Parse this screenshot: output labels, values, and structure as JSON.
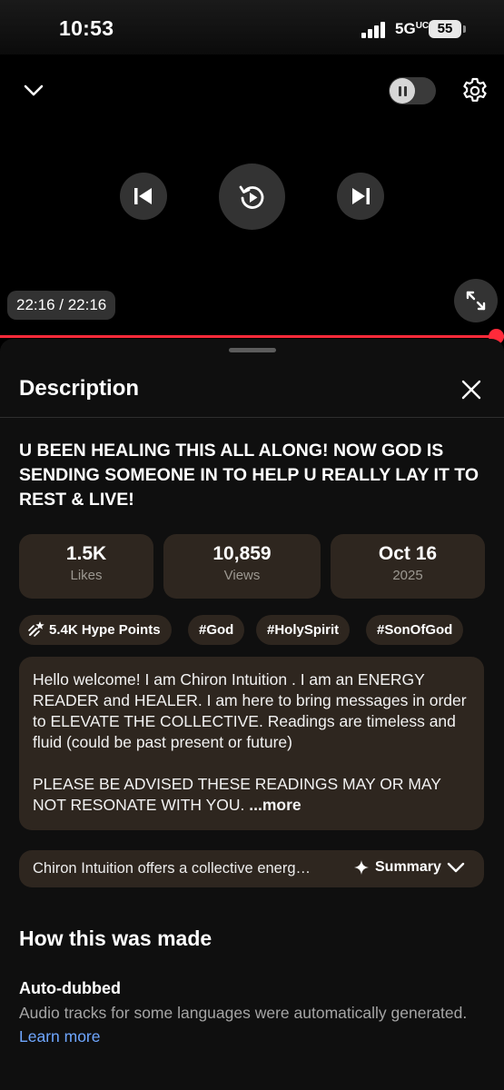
{
  "status_bar": {
    "time": "10:53",
    "network": "5G",
    "network_sup": "UC",
    "battery": "55"
  },
  "player": {
    "time": "22:16 / 22:16",
    "progress": 1.0
  },
  "sheet": {
    "title": "Description",
    "video_title": "U BEEN HEALING THIS ALL ALONG! NOW GOD IS SENDING SOMEONE IN TO HELP U REALLY LAY IT TO REST & LIVE!",
    "stats": [
      {
        "value": "1.5K",
        "label": "Likes"
      },
      {
        "value": "10,859",
        "label": "Views"
      },
      {
        "value": "Oct 16",
        "label": "2025"
      }
    ],
    "chips": [
      {
        "label": "5.4K Hype Points",
        "icon": "hype-icon"
      },
      {
        "label": "#God"
      },
      {
        "label": "#HolySpirit"
      },
      {
        "label": "#SonOfGod"
      }
    ],
    "description": {
      "para1": "Hello welcome! I am Chiron Intuition . I am an ENERGY READER and HEALER. I am here to bring messages in order to ELEVATE THE COLLECTIVE. Readings are timeless and fluid (could be past present or future)",
      "para2": "PLEASE BE ADVISED THESE READINGS MAY OR MAY NOT RESONATE WITH YOU.",
      "more": "...more"
    },
    "summary": {
      "text": "Chiron Intuition offers a collective energ…",
      "button": "Summary"
    },
    "how_made": {
      "heading": "How this was made",
      "item_title": "Auto-dubbed",
      "item_desc": "Audio tracks for some languages were automatically generated.",
      "link": "Learn more"
    }
  },
  "colors": {
    "accent": "#ff2a3a",
    "card": "#2e261f",
    "link": "#6fa7ff"
  }
}
